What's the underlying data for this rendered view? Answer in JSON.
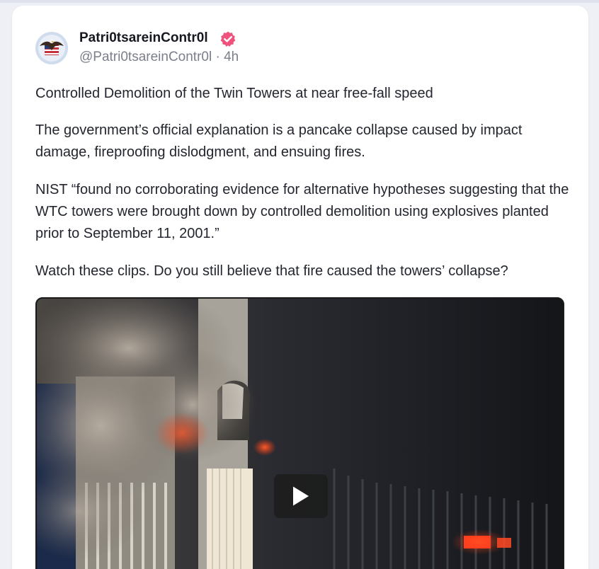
{
  "post": {
    "display_name": "Patri0tsareinContr0l",
    "handle": "@Patri0tsareinContr0l",
    "separator": " · ",
    "time": "4h",
    "verified_icon": "verified-badge-icon",
    "avatar_icon": "eagle-flag-avatar",
    "paragraphs": [
      "Controlled Demolition of the Twin Towers at near free-fall speed",
      "The government’s official explanation is a pancake collapse caused by impact damage, fireproofing dislodgment, and ensuing fires.",
      "NIST “found no corroborating evidence for alternative hypotheses suggesting that the WTC towers were brought down by controlled demolition using explosives planted prior to September 11, 2001.”",
      "Watch these clips. Do you still believe that fire caused the towers’ collapse?"
    ]
  },
  "video": {
    "play_icon": "play-icon"
  },
  "colors": {
    "verified": "#f0527e",
    "name": "#151820",
    "muted": "#7b7f8c",
    "text": "#23262f",
    "background": "#eef0f6"
  }
}
